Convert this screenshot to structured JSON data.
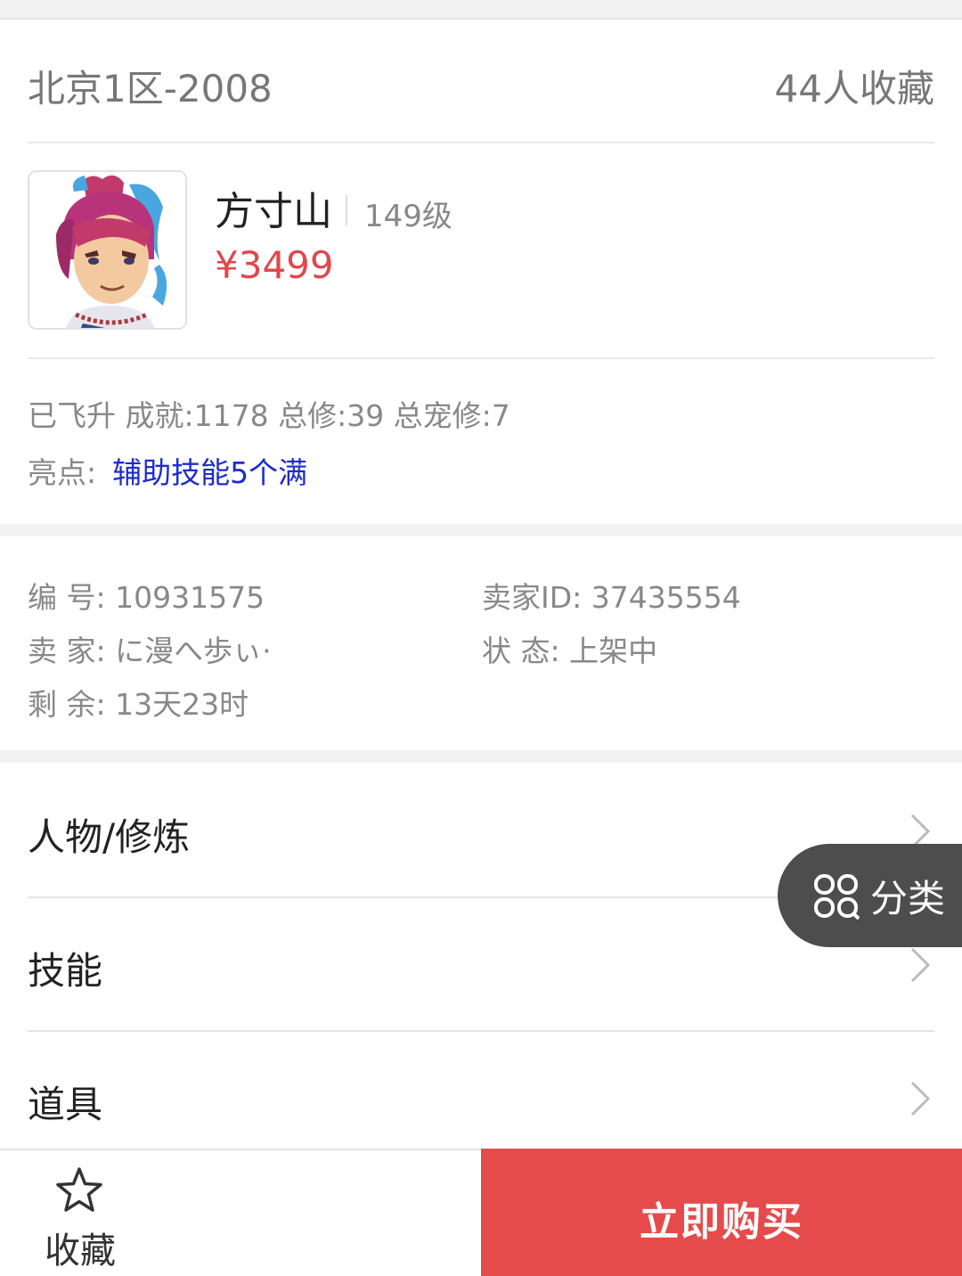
{
  "listing": {
    "server": "北京1区-2008",
    "favorites": "44人收藏"
  },
  "role": {
    "name": "方寸山",
    "level": "149级",
    "price": "¥3499",
    "stats": "已飞升 成就:1178 总修:39 总宠修:7",
    "highlight_label": "亮点:",
    "highlight_value": "辅助技能5个满"
  },
  "details": {
    "id": "编 号: 10931575",
    "seller_id": "卖家ID: 37435554",
    "seller": "卖 家: に漫へ歩ぃ·",
    "status": "状 态: 上架中",
    "remaining": "剩 余: 13天23时"
  },
  "menu": [
    {
      "label": "人物/修炼"
    },
    {
      "label": "技能"
    },
    {
      "label": "道具"
    }
  ],
  "float_button": {
    "label": "分类",
    "icon": "grid-icon"
  },
  "bottom_bar": {
    "favorite_label": "收藏",
    "favorite_icon": "star-icon",
    "buy_label": "立即购买"
  },
  "colors": {
    "price": "#e0474c",
    "highlight": "#1e2ccc",
    "buy_button": "#e64b4b",
    "float_button": "#4d4d4d"
  }
}
